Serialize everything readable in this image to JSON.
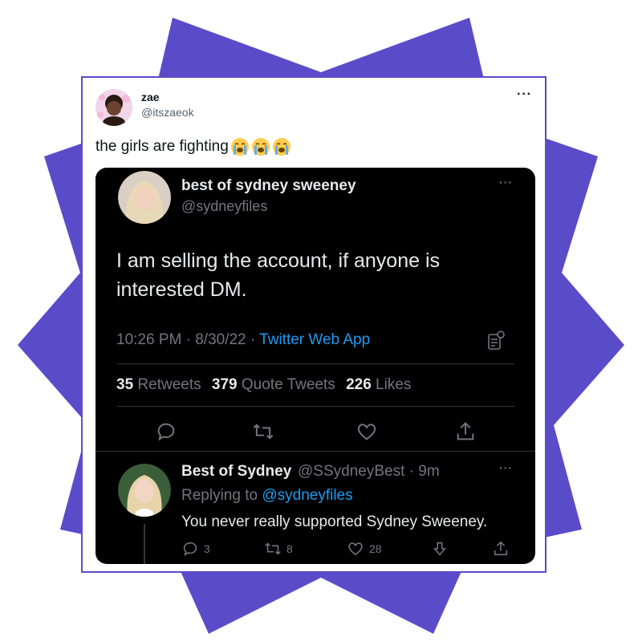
{
  "colors": {
    "starburst": "#5a4cc9",
    "card_border": "#5a4cc9",
    "link_blue": "#1d9bf0",
    "dark_bg": "#000000",
    "muted": "#71767b"
  },
  "outer_tweet": {
    "name": "zae",
    "handle": "@itszaeok",
    "text": "the girls are fighting",
    "emojis": [
      "loudly-crying-face",
      "loudly-crying-face",
      "loudly-crying-face"
    ],
    "more_icon": "more-icon"
  },
  "quoted_tweet": {
    "name": "best of sydney sweeney",
    "handle": "@sydneyfiles",
    "text": "I am selling the account, if anyone is interested DM.",
    "time": "10:26 PM",
    "date": "8/30/22",
    "source": "Twitter Web App",
    "stats": {
      "retweets_count": "35",
      "retweets_label": "Retweets",
      "quotes_count": "379",
      "quotes_label": "Quote Tweets",
      "likes_count": "226",
      "likes_label": "Likes"
    },
    "actions": [
      "reply-icon",
      "retweet-icon",
      "like-icon",
      "share-icon"
    ]
  },
  "reply_tweet": {
    "name": "Best of Sydney",
    "handle": "@SSydneyBest",
    "time": "9m",
    "replying_prefix": "Replying to",
    "replying_to": "@sydneyfiles",
    "text": "You never really supported Sydney Sweeney.",
    "reply_count": "3",
    "retweet_count": "8",
    "like_count": "28"
  }
}
